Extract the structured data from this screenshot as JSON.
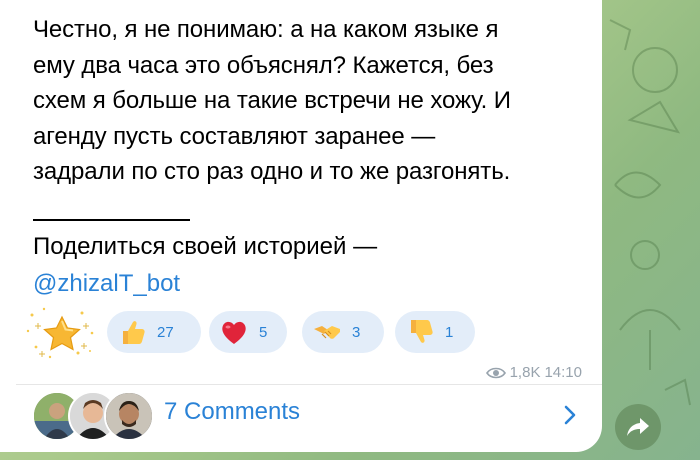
{
  "message": {
    "text": "Честно, я не понимаю: а на каком языке я\nему два часа это объяснял? Кажется, без\nсхем я больше на такие встречи не хожу. И\nагенду пусть составляют заранее —\nзадрали по сто раз одно и то же разгонять.",
    "share_prompt": "Поделиться своей историей —",
    "bot_handle": "@zhizalT_bot"
  },
  "reactions": [
    {
      "name": "thumbs-up",
      "count": "27"
    },
    {
      "name": "heart",
      "count": "5"
    },
    {
      "name": "handshake",
      "count": "3"
    },
    {
      "name": "thumbs-down",
      "count": "1"
    }
  ],
  "meta": {
    "views": "1,8K",
    "time": "14:10"
  },
  "comments": {
    "label": "7 Comments"
  },
  "colors": {
    "accent": "#2a82d6",
    "reaction_bg": "#e3edf9",
    "bubble": "#ffffff"
  }
}
